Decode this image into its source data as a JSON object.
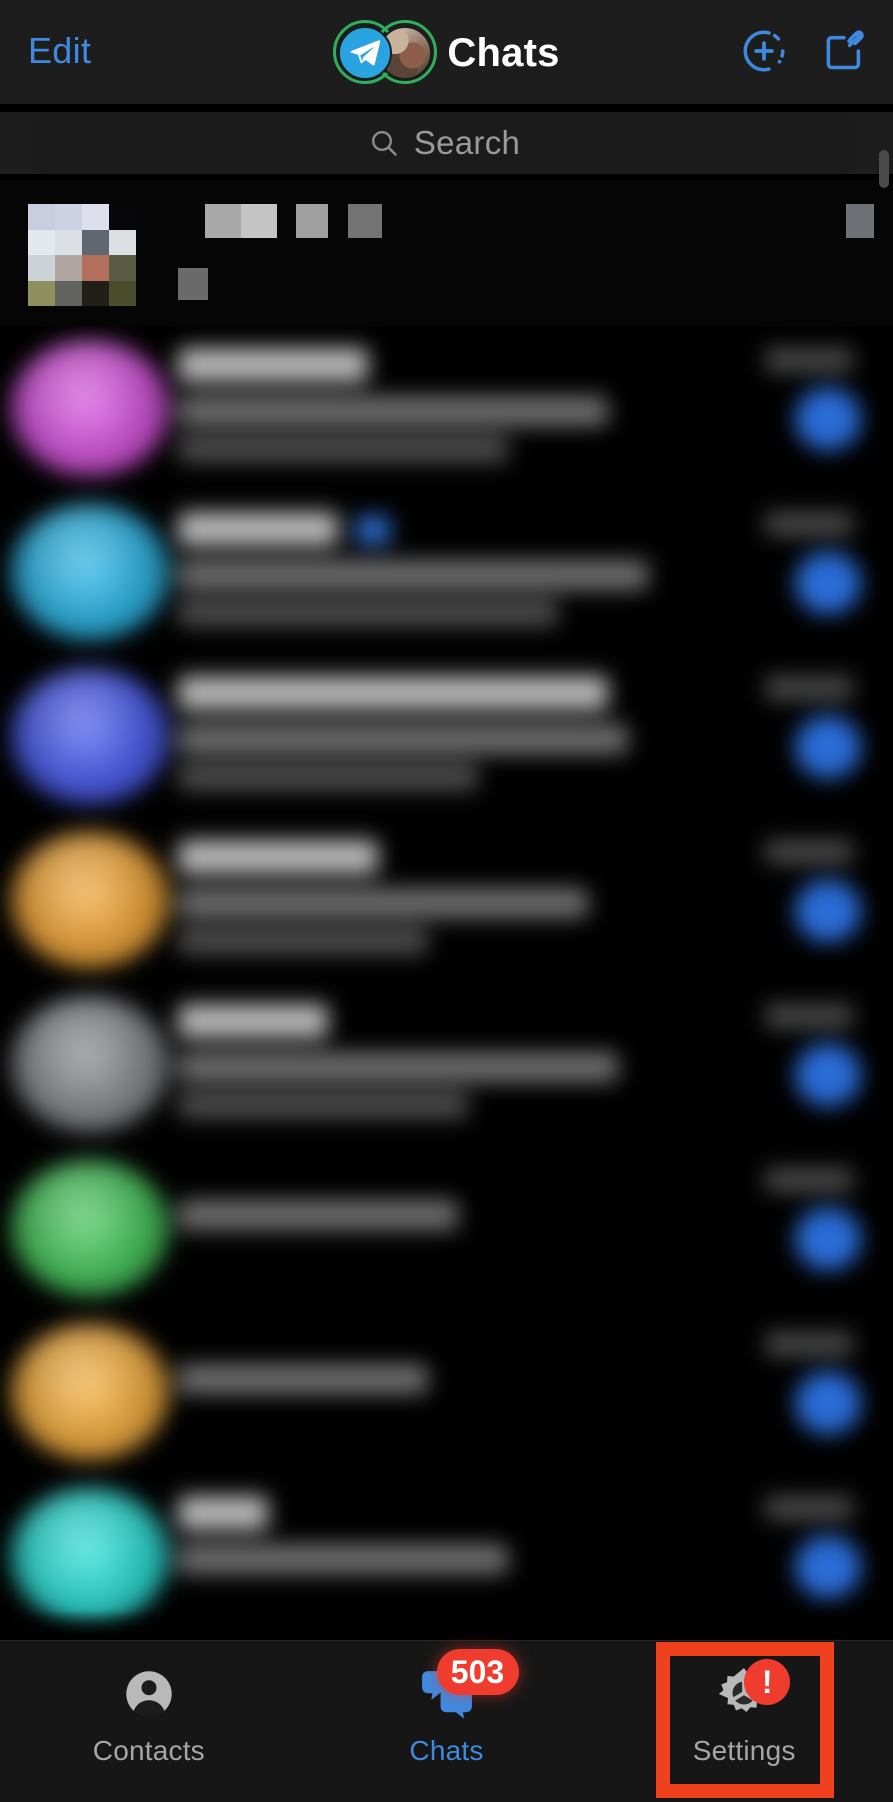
{
  "app": {
    "name": "Telegram",
    "screen_title": "Chats",
    "theme": "dark",
    "accent_color": "#3e8ae0",
    "badge_color": "#f03c2e",
    "annotation_color": "#f0411e",
    "story_ring_color": "#2fae5c"
  },
  "header": {
    "edit_label": "Edit",
    "title": "Chats",
    "avatar_telegram_icon": "telegram-plane-icon",
    "avatar_photo_icon": "user-photo-avatar",
    "story_ring": true,
    "actions": [
      {
        "name": "add-story-button",
        "icon": "circle-plus-dashed-icon"
      },
      {
        "name": "compose-button",
        "icon": "pencil-square-icon"
      }
    ]
  },
  "search": {
    "placeholder": "Search",
    "value": "",
    "icon": "search-icon"
  },
  "redacted_row": {
    "note": "pixelated",
    "avatar_colors": [
      "#c8cde0",
      "#ccd2e4",
      "#dde0ec",
      "#07070a",
      "#e2e9ec",
      "#dcdfe3",
      "#5f6870",
      "#dcdfe3",
      "#ccd3d6",
      "#b1a6a2",
      "#b3705c",
      "#5b5b43",
      "#8e8f5d",
      "#62625e",
      "#221f18",
      "#4b4c2c"
    ],
    "name_blocks": [
      "#a9a9a9",
      "#c4c4c4"
    ],
    "word_blocks": [
      "#a0a0a0",
      "#737373",
      "#6a6a6a"
    ],
    "right_block": "#6e7176"
  },
  "chats": {
    "rows": [
      {
        "avatar": "#d957e0",
        "name_w": 190,
        "msg1_w": 430,
        "msg2_w": 330,
        "badge": true,
        "check": false,
        "time": true
      },
      {
        "avatar": "#2fb8e8",
        "name_w": 160,
        "msg1_w": 470,
        "msg2_w": 380,
        "badge": true,
        "check": true,
        "time": true
      },
      {
        "avatar": "#4d5ff0",
        "name_w": 430,
        "msg1_w": 450,
        "msg2_w": 300,
        "badge": true,
        "check": false,
        "time": true
      },
      {
        "avatar": "#f3a93c",
        "name_w": 200,
        "msg1_w": 410,
        "msg2_w": 250,
        "badge": true,
        "check": false,
        "time": true
      },
      {
        "avatar": "#8a8croppedpl",
        "name_w": 150,
        "msg1_w": 440,
        "msg2_w": 290,
        "badge": true,
        "check": false,
        "time": true
      },
      {
        "avatar": "#49c85e",
        "name_w": 0,
        "msg1_w": 280,
        "msg2_w": 0,
        "badge": true,
        "check": false,
        "time": true
      },
      {
        "avatar": "#f5b041",
        "name_w": 0,
        "msg1_w": 250,
        "msg2_w": 0,
        "badge": true,
        "check": false,
        "time": true
      },
      {
        "avatar": "#2fe0d8",
        "name_w": 90,
        "msg1_w": 330,
        "msg2_w": 0,
        "badge": true,
        "check": false,
        "time": true
      }
    ]
  },
  "tabbar": {
    "items": [
      {
        "id": "contacts",
        "label": "Contacts",
        "icon": "person-circle-icon",
        "active": false,
        "badge": null
      },
      {
        "id": "chats",
        "label": "Chats",
        "icon": "chat-bubbles-icon",
        "active": true,
        "badge": "503"
      },
      {
        "id": "settings",
        "label": "Settings",
        "icon": "gear-icon",
        "active": false,
        "badge": "!"
      }
    ]
  },
  "annotation": {
    "target": "settings-tab",
    "shape": "rectangle",
    "color": "#f0411e"
  }
}
